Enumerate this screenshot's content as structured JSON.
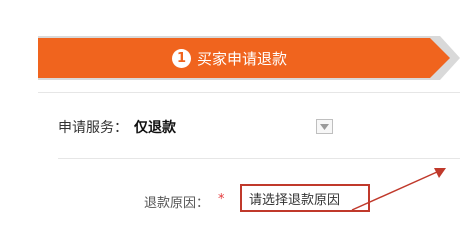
{
  "step": {
    "number": "1",
    "label": "买家申请退款",
    "color": "#f0641e"
  },
  "service": {
    "label": "申请服务：",
    "value": "仅退款",
    "dropdown_icon": "chevron-down-icon"
  },
  "refund_reason": {
    "label": "退款原因：",
    "required_mark": "*",
    "placeholder": "请选择退款原因",
    "highlight_color": "#c0392b"
  }
}
